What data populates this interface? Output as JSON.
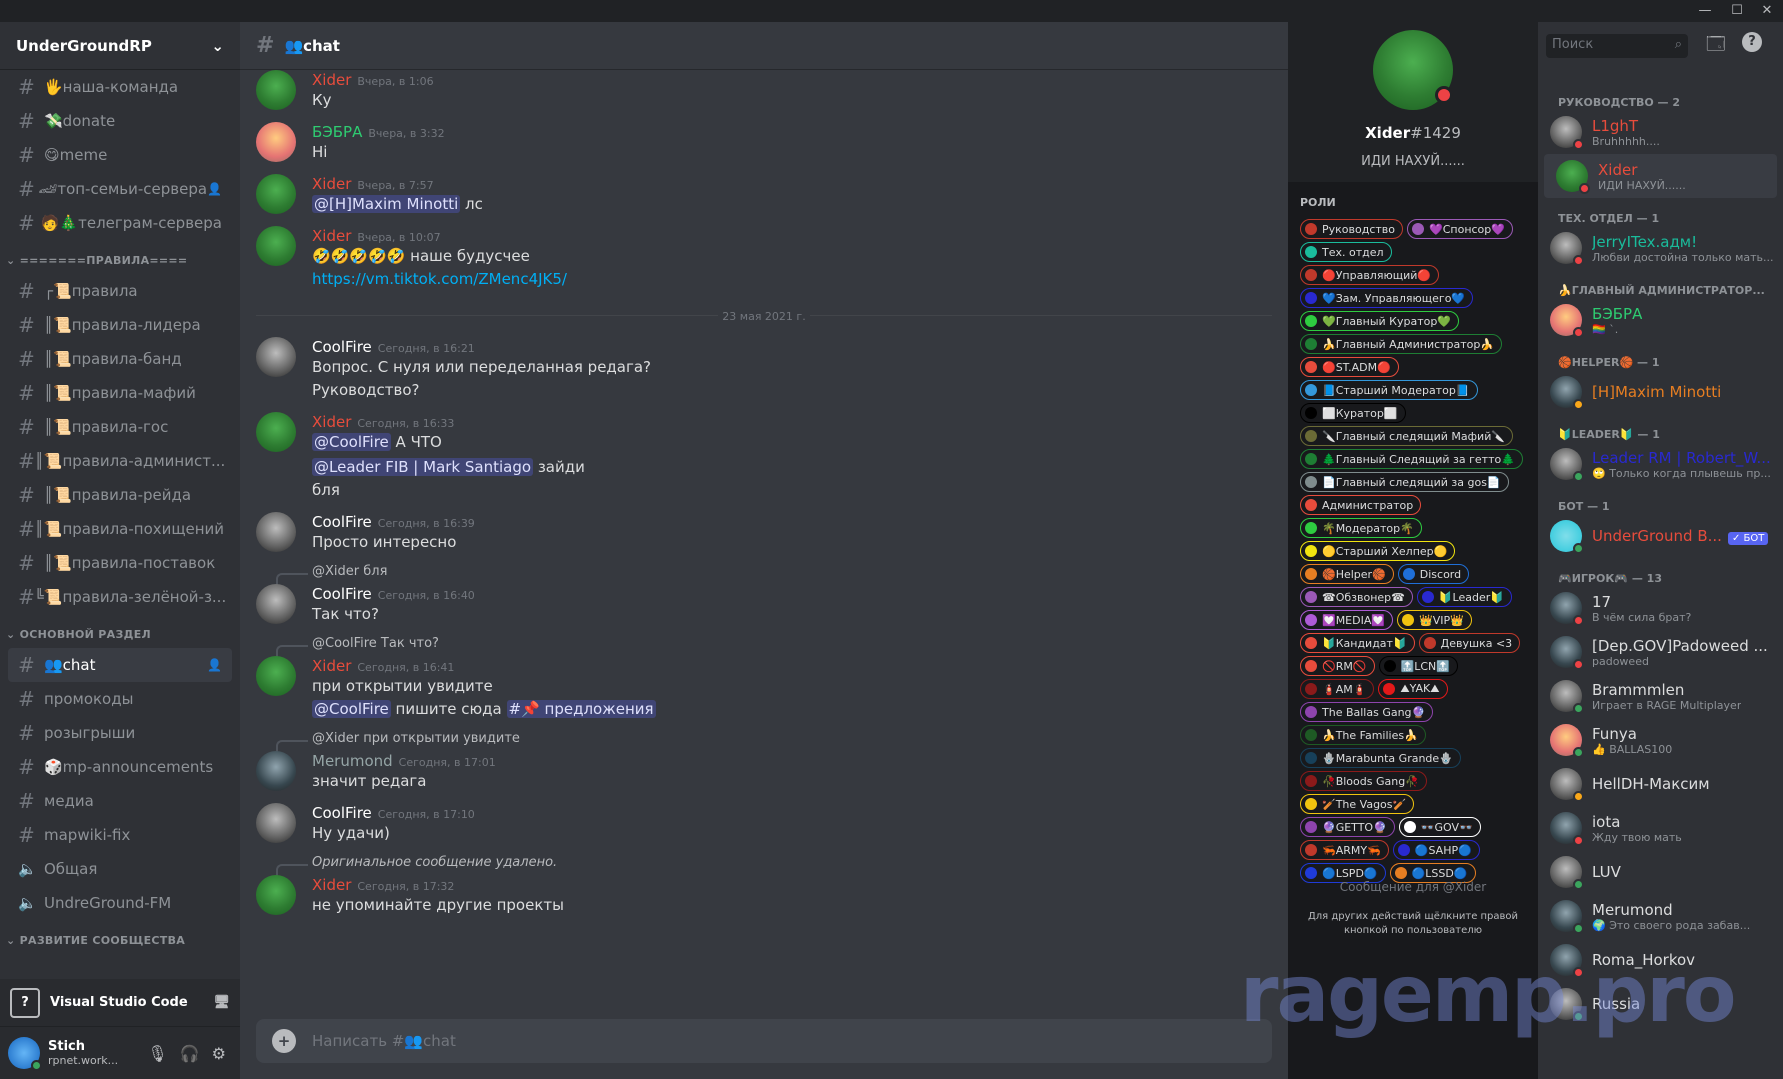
{
  "server": {
    "name": "UnderGroundRP"
  },
  "channels": [
    {
      "type": "ch",
      "label": "🖐наша-команда"
    },
    {
      "type": "ch",
      "label": "💸donate"
    },
    {
      "type": "ch",
      "label": "😋meme"
    },
    {
      "type": "ch",
      "label": "🏎топ-семьи-сервера",
      "hover": true
    },
    {
      "type": "ch",
      "label": "🧑🎄телеграм-сервера"
    },
    {
      "type": "cat",
      "label": "=======ПРАВИЛА===="
    },
    {
      "type": "ch",
      "label": "┌📜правила"
    },
    {
      "type": "ch",
      "label": "║📜правила-лидера"
    },
    {
      "type": "ch",
      "label": "║📜правила-банд"
    },
    {
      "type": "ch",
      "label": "║📜правила-мафий"
    },
    {
      "type": "ch",
      "label": "║📜правила-гос"
    },
    {
      "type": "ch",
      "label": "║📜правила-админист..."
    },
    {
      "type": "ch",
      "label": "║📜правила-рейда"
    },
    {
      "type": "ch",
      "label": "║📜правила-похищений"
    },
    {
      "type": "ch",
      "label": "║📜правила-поставок"
    },
    {
      "type": "ch",
      "label": "╚📜правила-зелёной-з..."
    },
    {
      "type": "cat",
      "label": "ОСНОВНОЙ РАЗДЕЛ"
    },
    {
      "type": "ch",
      "label": "👥chat",
      "active": true
    },
    {
      "type": "ch",
      "label": "промокоды"
    },
    {
      "type": "ch",
      "label": "розыгрыши"
    },
    {
      "type": "ch",
      "label": "🎲mp-announcements"
    },
    {
      "type": "ch",
      "label": "медиа"
    },
    {
      "type": "ch",
      "label": "mapwiki-fix"
    },
    {
      "type": "voice",
      "label": "Общая"
    },
    {
      "type": "voice",
      "label": "UndreGround-FM"
    },
    {
      "type": "cat",
      "label": "РАЗВИТИЕ СООБЩЕСТВА"
    }
  ],
  "rich_presence": {
    "label": "Visual Studio Code"
  },
  "user": {
    "name": "Stich",
    "status": "rpnet.work..."
  },
  "chat": {
    "channel_name": "👥chat",
    "composer_placeholder": "Написать #👥chat",
    "date_divider": "23 мая 2021 г."
  },
  "messages": [
    {
      "author": "Xider",
      "color": "#e74c3c",
      "avatar": "pepe",
      "time": "Вчера, в 1:06",
      "lines": [
        "Ку"
      ]
    },
    {
      "author": "БЭБРА",
      "color": "#2ecc71",
      "avatar": "pink",
      "time": "Вчера, в 3:32",
      "lines": [
        "Hi"
      ]
    },
    {
      "author": "Xider",
      "color": "#e74c3c",
      "avatar": "pepe",
      "time": "Вчера, в 7:57",
      "mention": "@[H]Maxim Minotti",
      "after": " лс"
    },
    {
      "author": "Xider",
      "color": "#e74c3c",
      "avatar": "pepe",
      "time": "Вчера, в 10:07",
      "lines": [
        "🤣🤣🤣🤣🤣 наше будусчее"
      ],
      "link": "https://vm.tiktok.com/ZMenc4JK5/"
    },
    {
      "author": "CoolFire",
      "color": "#ffffff",
      "avatar": "gray",
      "time": "Сегодня, в 16:21",
      "lines": [
        "Вопрос. С нуля или переделанная редага?",
        "Руководство?"
      ]
    },
    {
      "author": "Xider",
      "color": "#e74c3c",
      "avatar": "pepe",
      "time": "Сегодня, в 16:33",
      "m1": "@CoolFire",
      "t1": " А ЧТО",
      "m2": "@Leader FIB | Mark Santiago",
      "t2": " зайди",
      "t3": "бля"
    },
    {
      "author": "CoolFire",
      "color": "#ffffff",
      "avatar": "gray",
      "time": "Сегодня, в 16:39",
      "lines": [
        "Просто интересно"
      ]
    },
    {
      "reply": "@Xider бля",
      "author": "CoolFire",
      "color": "#ffffff",
      "avatar": "gray",
      "time": "Сегодня, в 16:40",
      "lines": [
        "Так что?"
      ]
    },
    {
      "reply": "@CoolFire Так что?",
      "author": "Xider",
      "color": "#e74c3c",
      "avatar": "pepe",
      "time": "Сегодня, в 16:41",
      "t1": "при открытии увидите",
      "m1": "@CoolFire",
      "t2": " пишите сюда ",
      "m2": "#📌 предложения"
    },
    {
      "reply": "@Xider при открытии увидите",
      "author": "Merumond",
      "color": "#95a5a6",
      "avatar": "dark",
      "time": "Сегодня, в 17:01",
      "lines": [
        "значит редага"
      ]
    },
    {
      "author": "CoolFire",
      "color": "#ffffff",
      "avatar": "gray",
      "time": "Сегодня, в 17:10",
      "lines": [
        "Ну удачи)"
      ]
    },
    {
      "reply": "Оригинальное сообщение удалено.",
      "author": "Xider",
      "color": "#e74c3c",
      "avatar": "pepe",
      "time": "Сегодня, в 17:32",
      "lines": [
        "не упоминайте другие проекты"
      ]
    }
  ],
  "profile": {
    "username": "Xider",
    "discriminator": "#1429",
    "custom_status": "ИДИ НАХУЙ......",
    "roles_title": "РОЛИ",
    "roles": [
      [
        {
          "n": "Руководство",
          "c": "#c0392b"
        },
        {
          "n": "💜Спонсор💜",
          "c": "#9b59b6"
        }
      ],
      [
        {
          "n": "Тех. отдел",
          "c": "#1abc9c"
        }
      ],
      [
        {
          "n": "🔴Управляющий🔴",
          "c": "#c0392b"
        }
      ],
      [
        {
          "n": "💙Зам. Управляющего💙",
          "c": "#2929d0"
        }
      ],
      [
        {
          "n": "💚Главный Куратор💚",
          "c": "#2ecc40"
        }
      ],
      [
        {
          "n": "🍌Главный Администратор🍌",
          "c": "#1e7e34"
        }
      ],
      [
        {
          "n": "🔴ST.ADM🔴",
          "c": "#e74c3c"
        }
      ],
      [
        {
          "n": "📘Старший Модератор📘",
          "c": "#3498db"
        }
      ],
      [
        {
          "n": "⬜Куратор⬜",
          "c": "#000000"
        }
      ],
      [
        {
          "n": "🔪Главный следящий Мафий🔪",
          "c": "#6b6b36"
        }
      ],
      [
        {
          "n": "🌲Главный Следящий за гетто🌲",
          "c": "#1e7e34"
        }
      ],
      [
        {
          "n": "📄Главный следящий за gos📄",
          "c": "#7f8c8d"
        }
      ],
      [
        {
          "n": "Администратор",
          "c": "#e74c3c"
        }
      ],
      [
        {
          "n": "🌴Модератор🌴",
          "c": "#2ecc40"
        }
      ],
      [
        {
          "n": "🟡Старший Хелпер🟡",
          "c": "#f1e40f"
        }
      ],
      [
        {
          "n": "🏀Helper🏀",
          "c": "#e67e22"
        },
        {
          "n": "Discord",
          "c": "#1f6fd8"
        }
      ],
      [
        {
          "n": "☎Обзвонер☎",
          "c": "#9b59b6"
        },
        {
          "n": "🔰Leader🔰",
          "c": "#2929d0"
        }
      ],
      [
        {
          "n": "💟MEDIA💟",
          "c": "#ad5bd6"
        },
        {
          "n": "👑VIP👑",
          "c": "#f1c40f"
        }
      ],
      [
        {
          "n": "🔰Кандидат🔰",
          "c": "#e74c3c"
        },
        {
          "n": "Девушка <3",
          "c": "#c0392b"
        }
      ],
      [
        {
          "n": "🚫RM🚫",
          "c": "#e74c3c"
        },
        {
          "n": "🔝LCN🔝",
          "c": "#000000"
        }
      ],
      [
        {
          "n": "🧯AM🧯",
          "c": "#8b1a1a"
        },
        {
          "n": "⛰YAK⛰",
          "c": "#e31919"
        }
      ],
      [
        {
          "n": "The Ballas Gang🔮",
          "c": "#8e44ad"
        }
      ],
      [
        {
          "n": "🍌The Families🍌",
          "c": "#1e5a24"
        }
      ],
      [
        {
          "n": "🪬Marabunta Grande🪬",
          "c": "#17405a"
        }
      ],
      [
        {
          "n": "🥀Bloods Gang🥀",
          "c": "#8b1a1a"
        }
      ],
      [
        {
          "n": "🏏The Vagos🏏",
          "c": "#f1c40f"
        }
      ],
      [
        {
          "n": "🔮GETTO🔮",
          "c": "#8e44ad"
        },
        {
          "n": "👓GOV👓",
          "c": "#ffffff"
        }
      ],
      [
        {
          "n": "🦐ARMY🦐",
          "c": "#c0392b"
        },
        {
          "n": "🔵SAHP🔵",
          "c": "#2929d0"
        }
      ],
      [
        {
          "n": "🔵LSPD🔵",
          "c": "#1f3bd8"
        },
        {
          "n": "🔵LSSD🔵",
          "c": "#e67e22"
        }
      ]
    ],
    "message_placeholder": "Сообщение для @Xider",
    "hint": "Для других действий щёлкните правой кнопкой по пользователю"
  },
  "members": {
    "search_placeholder": "Поиск",
    "groups": [
      {
        "title": "РУКОВОДСТВО — 2",
        "items": [
          {
            "name": "L1ghT",
            "color": "#e74c3c",
            "sub": "Bruhhhhh....",
            "av": "gray",
            "st": "#ed4245"
          },
          {
            "name": "Xider",
            "color": "#e74c3c",
            "sub": "ИДИ НАХУЙ......",
            "av": "pepe",
            "st": "#ed4245",
            "active": true
          }
        ]
      },
      {
        "title": "ТЕХ. ОТДЕЛ — 1",
        "items": [
          {
            "name": "JerryITex.адм!",
            "color": "#1abc9c",
            "sub": "Любви достойна только мать...",
            "av": "gray",
            "st": "#ed4245"
          }
        ]
      },
      {
        "title": "🍌ГЛАВНЫЙ АДМИНИСТРАТОР...",
        "items": [
          {
            "name": "БЭБРА",
            "color": "#2ecc71",
            "sub": "🏳‍🌈 `.",
            "av": "pink",
            "st": "#ed4245"
          }
        ]
      },
      {
        "title": "🏀HELPER🏀 — 1",
        "items": [
          {
            "name": "[H]Maxim Minotti",
            "color": "#e67e22",
            "sub": "",
            "av": "dark",
            "st": "#faa81a"
          }
        ]
      },
      {
        "title": "🔰LEADER🔰 — 1",
        "items": [
          {
            "name": "Leader RM | Robert_W...",
            "color": "#2929d0",
            "sub": "🙄 Только когда плывешь пр...",
            "av": "gray",
            "st": "#3ba55d"
          }
        ]
      },
      {
        "title": "БОТ — 1",
        "items": [
          {
            "name": "UnderGround B...",
            "color": "#e74c3c",
            "sub": "",
            "av": "bot",
            "st": "#3ba55d",
            "bot": "✓ БОТ"
          }
        ]
      },
      {
        "title": "🎮ИГРОК🎮 — 13",
        "items": [
          {
            "name": "17",
            "color": "#dcddde",
            "sub": "В чём сила брат?",
            "av": "dark",
            "st": "#ed4245"
          },
          {
            "name": "[Dep.GOV]Padoweed ...",
            "color": "#dcddde",
            "sub": "padoweed",
            "av": "dark",
            "st": "#ed4245"
          },
          {
            "name": "Brammmlen",
            "color": "#dcddde",
            "sub": "Играет в RAGE Multiplayer",
            "av": "gray",
            "st": "#3ba55d"
          },
          {
            "name": "Funya",
            "color": "#dcddde",
            "sub": "👍 BALLAS100",
            "av": "pink",
            "st": "#3ba55d"
          },
          {
            "name": "HellDH-Максим",
            "color": "#dcddde",
            "sub": "",
            "av": "gray",
            "st": "#faa81a"
          },
          {
            "name": "iota",
            "color": "#dcddde",
            "sub": "Жду твою мать",
            "av": "dark",
            "st": "#ed4245"
          },
          {
            "name": "LUV",
            "color": "#dcddde",
            "sub": "",
            "av": "gray",
            "st": "#3ba55d"
          },
          {
            "name": "Merumond",
            "color": "#dcddde",
            "sub": "🌍 Это своего рода забав...",
            "av": "dark",
            "st": "#3ba55d"
          },
          {
            "name": "Roma_Horkov",
            "color": "#dcddde",
            "sub": "",
            "av": "dark",
            "st": "#ed4245"
          },
          {
            "name": "Russia",
            "color": "#dcddde",
            "sub": "",
            "av": "gray",
            "st": "#3ba55d"
          }
        ]
      }
    ]
  },
  "watermark": "ragemp.pro"
}
